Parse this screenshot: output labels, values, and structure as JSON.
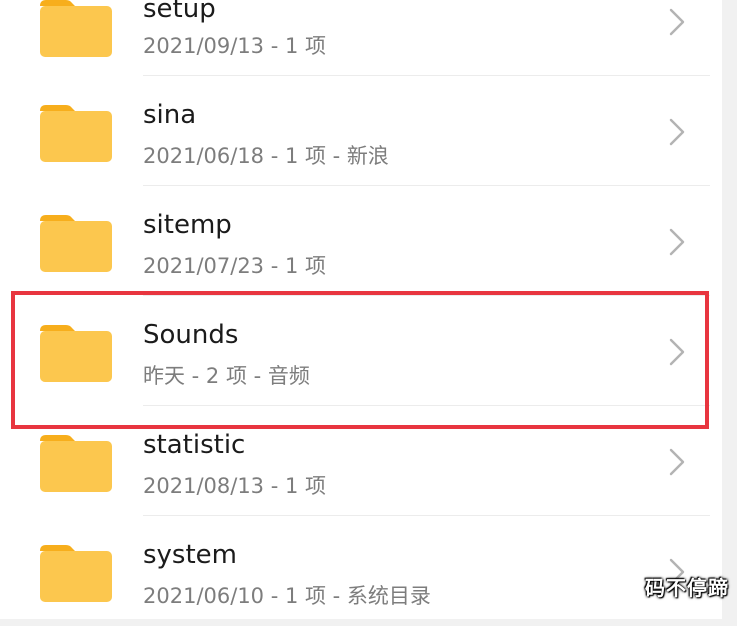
{
  "folders": [
    {
      "name": "setup",
      "meta": "2021/09/13 - 1 项"
    },
    {
      "name": "sina",
      "meta": "2021/06/18 - 1 项 - 新浪"
    },
    {
      "name": "sitemp",
      "meta": "2021/07/23 - 1 项"
    },
    {
      "name": "Sounds",
      "meta": "昨天 - 2 项 - 音频"
    },
    {
      "name": "statistic",
      "meta": "2021/08/13 - 1 项"
    },
    {
      "name": "system",
      "meta": "2021/06/10 - 1 项 - 系统目录"
    }
  ],
  "watermark": "码不停蹄",
  "colors": {
    "folder_body": "#fcc74e",
    "folder_tab": "#f7ae1c",
    "highlight_border": "#e8353f",
    "chevron": "#b3b3b3"
  },
  "icons": {
    "folder": "folder-icon",
    "chevron": "chevron-right-icon"
  }
}
